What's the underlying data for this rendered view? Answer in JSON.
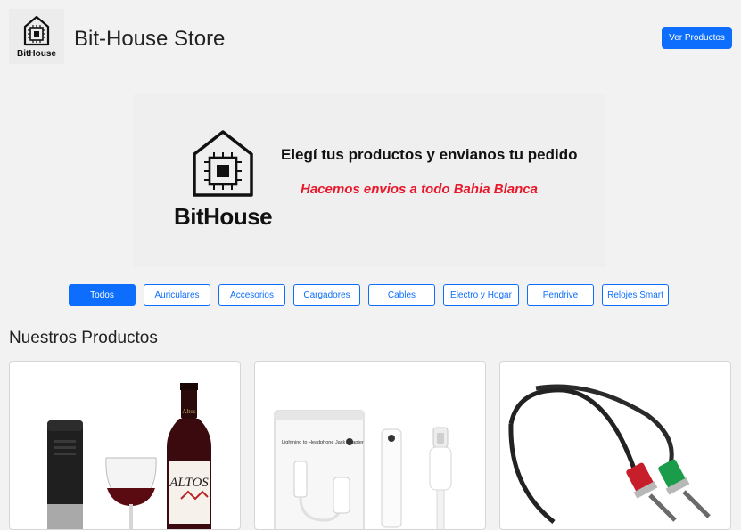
{
  "header": {
    "logo_text": "BitHouse",
    "title": "Bit-House Store",
    "products_button": "Ver Productos"
  },
  "banner": {
    "brand": "BitHouse",
    "line1": "Elegí tus productos y envianos tu pedido",
    "line2": "Hacemos envios a todo Bahia Blanca"
  },
  "filters": [
    {
      "label": "Todos",
      "active": true
    },
    {
      "label": "Auriculares",
      "active": false
    },
    {
      "label": "Accesorios",
      "active": false
    },
    {
      "label": "Cargadores",
      "active": false
    },
    {
      "label": "Cables",
      "active": false
    },
    {
      "label": "Electro y Hogar",
      "active": false
    },
    {
      "label": "Pendrive",
      "active": false
    },
    {
      "label": "Relojes Smart",
      "active": false
    }
  ],
  "products_section": {
    "title": "Nuestros Productos"
  },
  "products": [
    {
      "image": "electric-wine-opener-with-glass-and-bottle",
      "bottle_label": "ALTOS"
    },
    {
      "image": "lightning-to-headphone-jack-adapter",
      "box_text": "Lightning to Headphone Jack Adapter"
    },
    {
      "image": "headset-audio-splitter-cable"
    }
  ],
  "colors": {
    "primary": "#0d6efd",
    "accent_red": "#e8192c",
    "background": "#f2f2f2"
  }
}
